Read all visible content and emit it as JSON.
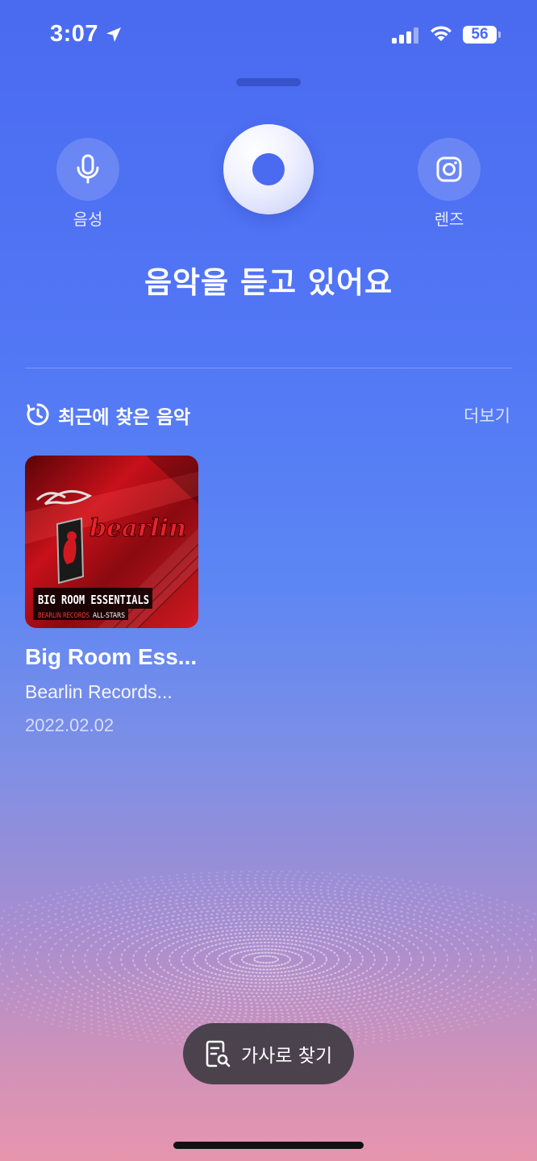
{
  "status_bar": {
    "time": "3:07",
    "battery": "56",
    "icons": [
      "location-arrow-icon",
      "cellular-signal-icon",
      "wifi-icon",
      "battery-icon"
    ]
  },
  "actions": {
    "voice_label": "음성",
    "lens_label": "렌즈"
  },
  "listening_title": "음악을 듣고 있어요",
  "recent": {
    "title": "최근에 찾은 음악",
    "more_label": "더보기",
    "items": [
      {
        "title": "Big Room Ess...",
        "artist": "Bearlin Records...",
        "date": "2022.02.02",
        "cover_logo": "bearlin",
        "cover_title": "BIG ROOM ESSENTIALS",
        "cover_subtitle_a": "BEARLIN RECORDS",
        "cover_subtitle_b": "ALL-STARS"
      }
    ]
  },
  "lyrics_button": {
    "label": "가사로 찾기"
  },
  "colors": {
    "gradient_top": "#4a6af0",
    "gradient_bottom": "#e795ad",
    "pill_bg": "#34343a"
  }
}
